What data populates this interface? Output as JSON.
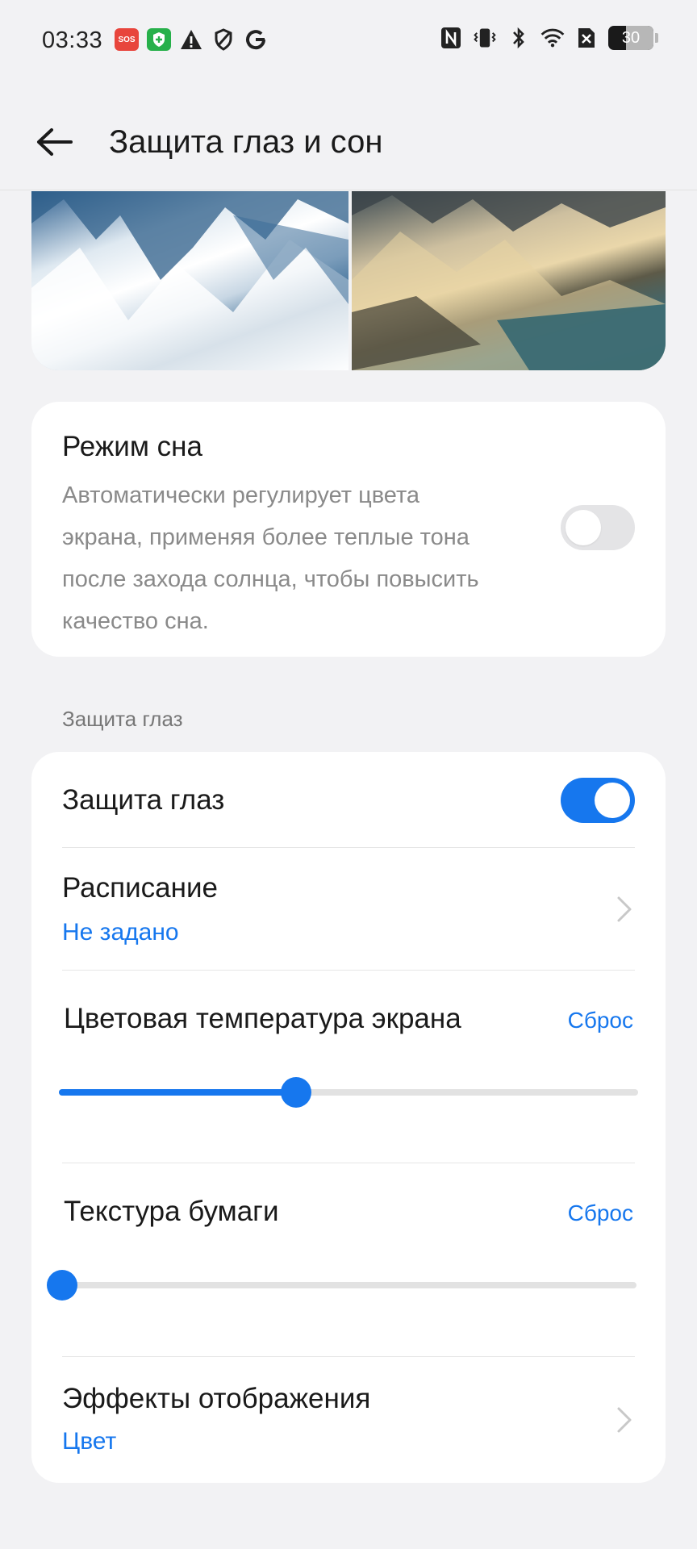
{
  "status_bar": {
    "time": "03:33",
    "sos_label": "SOS",
    "battery": "30",
    "left_icons": [
      "sos-icon",
      "security-shield-icon",
      "warning-icon",
      "shield-icon",
      "google-icon"
    ],
    "right_icons": [
      "nfc-icon",
      "vibrate-icon",
      "bluetooth-icon",
      "wifi-icon",
      "no-sim-icon",
      "battery-icon"
    ]
  },
  "header": {
    "title": "Защита глаз и сон"
  },
  "sleep_mode": {
    "title": "Режим сна",
    "description": "Автоматически регулирует цвета экрана, применяя более теплые тона после захода солнца, чтобы повысить качество сна.",
    "enabled": false
  },
  "eye_protection": {
    "section_label": "Защита глаз",
    "toggle_label": "Защита глаз",
    "enabled": true,
    "schedule": {
      "label": "Расписание",
      "value": "Не задано"
    },
    "color_temperature": {
      "label": "Цветовая температура экрана",
      "reset_label": "Сброс",
      "level": 0.41
    },
    "paper_texture": {
      "label": "Текстура бумаги",
      "reset_label": "Сброс",
      "level": 0.0
    },
    "display_effects": {
      "label": "Эффекты отображения",
      "value": "Цвет"
    }
  },
  "colors": {
    "accent": "#1677ee",
    "background": "#f2f2f4",
    "card": "#ffffff",
    "secondary_text": "#8a8a8a"
  }
}
